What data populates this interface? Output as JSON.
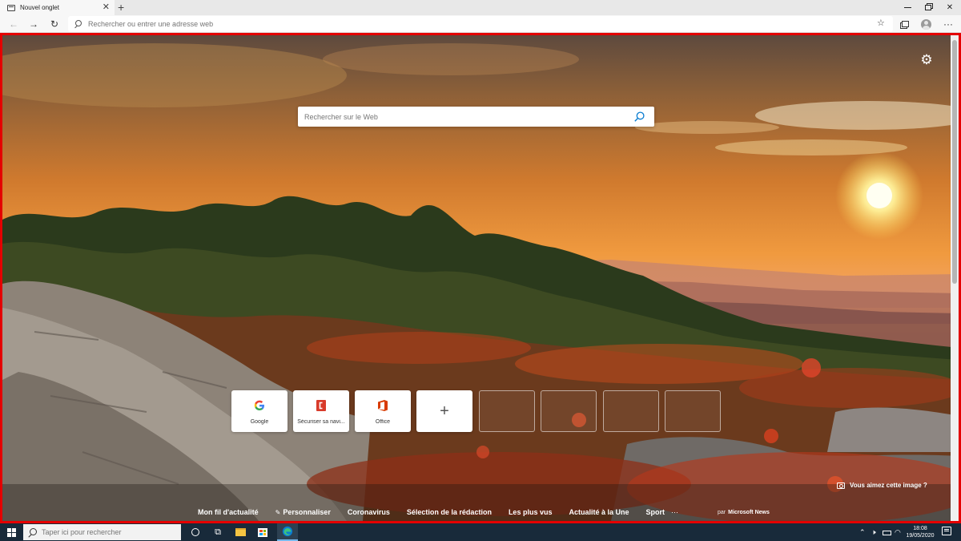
{
  "tab": {
    "title": "Nouvel onglet",
    "close_glyph": "✕",
    "new_tab_glyph": "+"
  },
  "window_controls": {
    "close_glyph": "✕"
  },
  "navigation": {
    "back_glyph": "←",
    "forward_glyph": "→",
    "refresh_glyph": "↻"
  },
  "address_bar": {
    "placeholder": "Rechercher ou entrer une adresse web",
    "value": ""
  },
  "toolbar": {
    "favorite_glyph": "☆",
    "menu_glyph": "···"
  },
  "new_tab_page": {
    "settings_glyph": "⚙",
    "search": {
      "placeholder": "Rechercher sur le Web",
      "value": ""
    },
    "quick_links": [
      {
        "label": "Google",
        "icon": "google-icon"
      },
      {
        "label": "Sécuriser sa navi...",
        "icon": "security-app-icon"
      },
      {
        "label": "Office",
        "icon": "office-icon"
      }
    ],
    "add_tile_glyph": "+",
    "image_prompt": "Vous aimez cette image ?",
    "news_nav": {
      "items": [
        "Mon fil d'actualité",
        "Personnaliser",
        "Coronavirus",
        "Sélection de la rédaction",
        "Les plus vus",
        "Actualité à la Une",
        "Sport"
      ],
      "pencil_glyph": "✎",
      "more_glyph": "···",
      "provider_prefix": "par",
      "provider_name": "Microsoft News"
    }
  },
  "taskbar": {
    "search_placeholder": "Taper ici pour rechercher",
    "taskview_glyph": "⧉",
    "tray": {
      "chevron_glyph": "⌃",
      "network_x_glyph": "🕨",
      "wifi_glyph": "◠"
    },
    "clock": {
      "time": "18:08",
      "date": "19/05/2020"
    }
  },
  "colors": {
    "accent_border": "#e40000",
    "edge_blue": "#0a7dd1",
    "office_red": "#d83b01",
    "taskbar_bg": "#182a3a"
  }
}
